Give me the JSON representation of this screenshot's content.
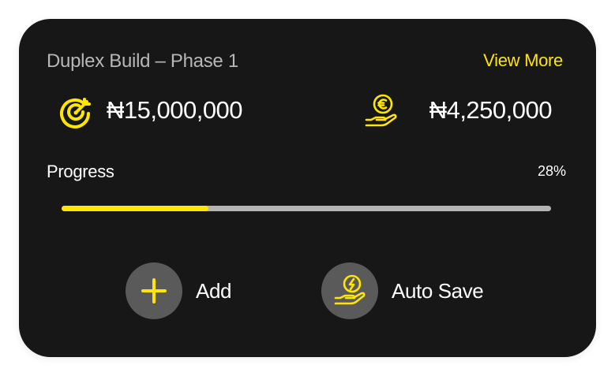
{
  "project": {
    "title": "Duplex Build – Phase 1",
    "view_more_label": "View More"
  },
  "amounts": {
    "target": "₦15,000,000",
    "target_icon": "target-icon",
    "saved": "₦4,250,000",
    "saved_icon": "euro-coin-hand-icon"
  },
  "progress": {
    "label": "Progress",
    "percent_text": "28%",
    "fraction": 0.3
  },
  "actions": {
    "add_label": "Add",
    "add_icon": "plus-icon",
    "autosave_label": "Auto Save",
    "autosave_icon": "lightning-hand-icon"
  },
  "colors": {
    "accent": "#ffe600",
    "card_bg": "#171717",
    "track": "#b4b4b4",
    "button_bg": "#5a5a5a"
  }
}
